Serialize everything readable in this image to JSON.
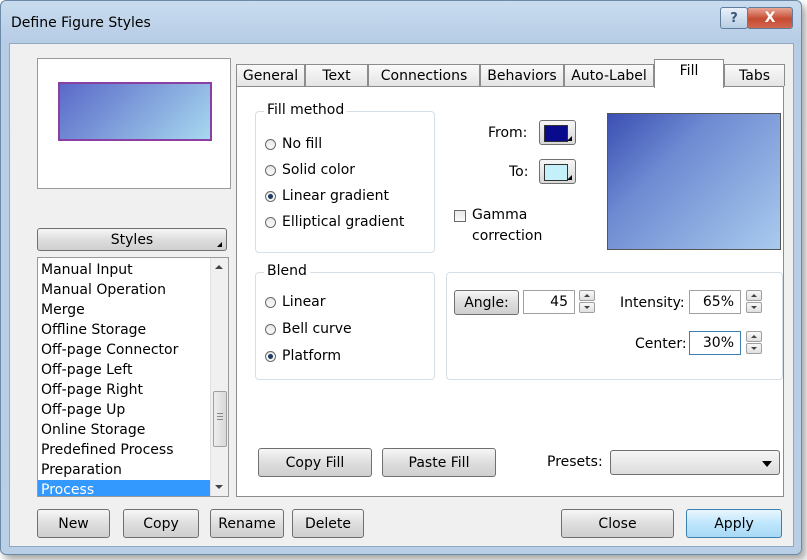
{
  "window": {
    "title": "Define Figure Styles",
    "help_glyph": "?",
    "close_glyph": "X"
  },
  "left": {
    "styles_button": "Styles",
    "list_items": [
      "Manual Input",
      "Manual Operation",
      "Merge",
      "Offline Storage",
      "Off-page Connector",
      "Off-page Left",
      "Off-page Right",
      "Off-page Up",
      "Online Storage",
      "Predefined Process",
      "Preparation",
      "Process"
    ],
    "selected_item": "Process"
  },
  "tabs": [
    "General",
    "Text",
    "Connections",
    "Behaviors",
    "Auto-Label",
    "Fill",
    "Tabs"
  ],
  "active_tab": "Fill",
  "fill": {
    "fill_method_title": "Fill method",
    "methods": [
      "No fill",
      "Solid color",
      "Linear gradient",
      "Elliptical gradient"
    ],
    "selected_method": "Linear gradient",
    "from_label": "From:",
    "to_label": "To:",
    "from_color": "#0a0a8c",
    "to_color": "#c4f0fa",
    "gamma_label_1": "Gamma",
    "gamma_label_2": "correction",
    "gamma_checked": false,
    "blend_title": "Blend",
    "blends": [
      "Linear",
      "Bell curve",
      "Platform"
    ],
    "selected_blend": "Platform",
    "angle_button": "Angle:",
    "angle_value": "45",
    "intensity_label": "Intensity:",
    "intensity_value": "65%",
    "center_label": "Center:",
    "center_value": "30%",
    "copy_fill": "Copy Fill",
    "paste_fill": "Paste Fill",
    "presets_label": "Presets:",
    "presets_value": ""
  },
  "bottom": {
    "new": "New",
    "copy": "Copy",
    "rename": "Rename",
    "delete": "Delete",
    "close": "Close",
    "apply": "Apply"
  }
}
